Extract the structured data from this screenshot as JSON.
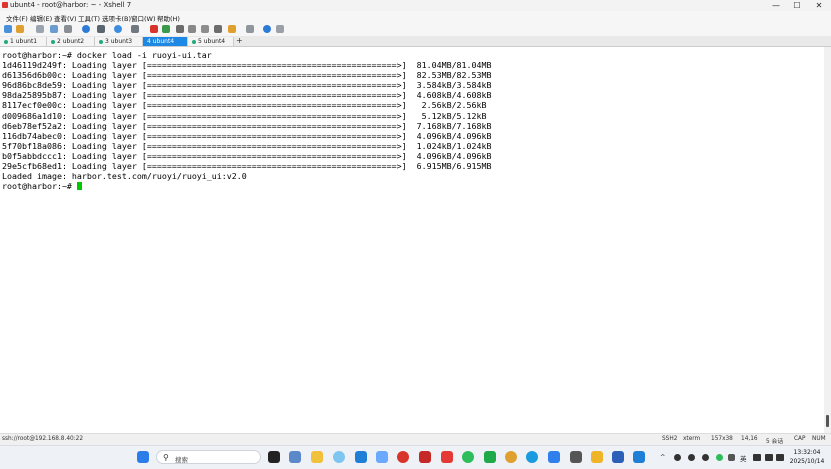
{
  "window": {
    "title": "ubunt4 - root@harbor: ~ - Xshell 7",
    "controls": [
      "—",
      "☐",
      "✕"
    ]
  },
  "menu": [
    "文件(F)",
    "编辑(E)",
    "查看(V)",
    "工具(T)",
    "选项卡(B)",
    "窗口(W)",
    "帮助(H)"
  ],
  "tabs": [
    {
      "label": "1 ubunt1",
      "active": false
    },
    {
      "label": "2 ubunt2",
      "active": false
    },
    {
      "label": "3 ubunt3",
      "active": false
    },
    {
      "label": "4 ubunt4",
      "active": true
    },
    {
      "label": "5 ubunt4",
      "active": false
    }
  ],
  "tab_add": "+",
  "terminal": {
    "lines": [
      "root@harbor:~# docker load -i ruoyi-ui.tar",
      "1d46119d249f: Loading layer [==================================================>]  81.04MB/81.04MB",
      "d61356d6b00c: Loading layer [==================================================>]  82.53MB/82.53MB",
      "96d86bc8de59: Loading layer [==================================================>]  3.584kB/3.584kB",
      "98da25895b87: Loading layer [==================================================>]  4.608kB/4.608kB",
      "8117ecf0e00c: Loading layer [==================================================>]   2.56kB/2.56kB",
      "d009686a1d10: Loading layer [==================================================>]   5.12kB/5.12kB",
      "d6eb78ef52a2: Loading layer [==================================================>]  7.168kB/7.168kB",
      "116db74abec0: Loading layer [==================================================>]  4.096kB/4.096kB",
      "5f70bf18a086: Loading layer [==================================================>]  1.024kB/1.024kB",
      "b0f5abbdccc1: Loading layer [==================================================>]  4.096kB/4.096kB",
      "29e5cfb68ed1: Loading layer [==================================================>]  6.915MB/6.915MB",
      "Loaded image: harbor.test.com/ruoyi/ruoyi_ui:v2.0"
    ],
    "prompt": "root@harbor:~# "
  },
  "status": {
    "connection": "ssh://root@192.168.8.40:22",
    "protocol": "SSH2",
    "terminal_type": "xterm",
    "size": "157x38",
    "cursor_pos": "14,16",
    "sessions": "5 会话",
    "cap": "CAP",
    "num": "NUM"
  },
  "taskbar": {
    "search_placeholder": "搜索",
    "ime": "英",
    "time": "13:32:04",
    "date": "2025/10/14"
  },
  "colors": {
    "cursor": "#00c800",
    "active_tab": "#1e88e5"
  }
}
